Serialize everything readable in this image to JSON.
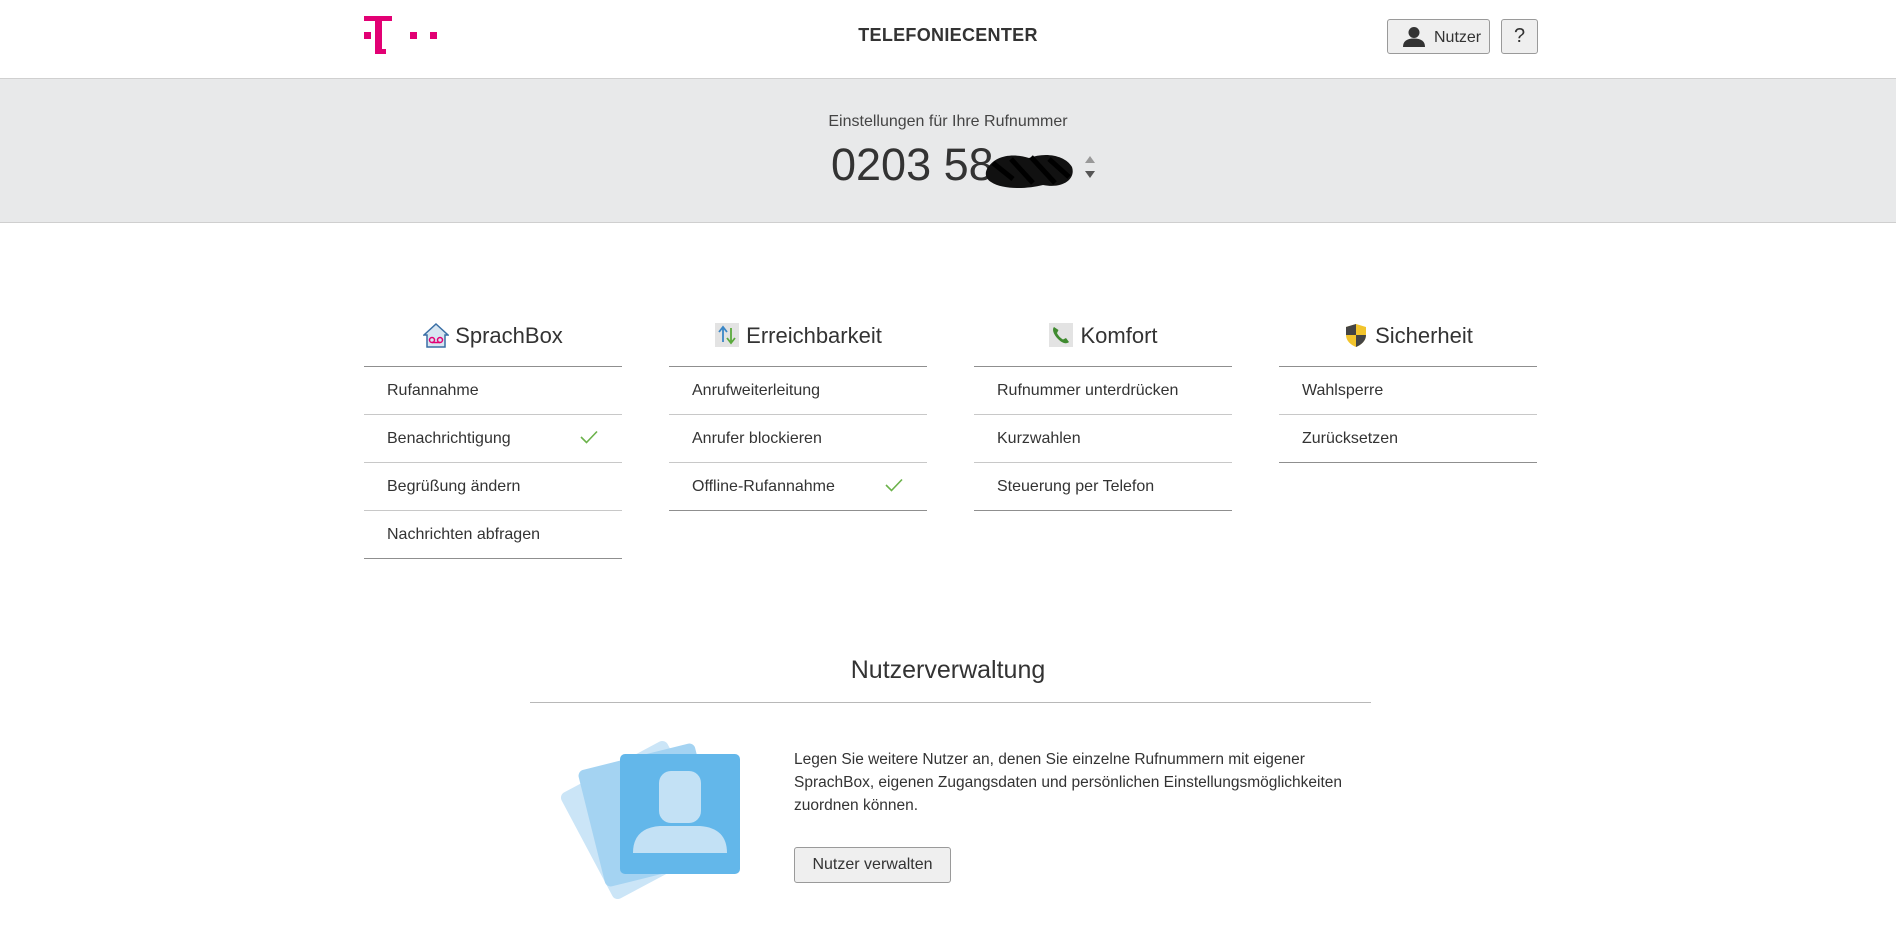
{
  "header": {
    "title": "TELEFONIECENTER",
    "user_button": "Nutzer",
    "help_button": "?",
    "brand_color": "#e20074"
  },
  "number_section": {
    "label": "Einstellungen für Ihre Rufnummer",
    "number_visible": "0203 58"
  },
  "categories": [
    {
      "title": "SprachBox",
      "icon": "voicemail-house-icon",
      "items": [
        {
          "label": "Rufannahme",
          "checked": false
        },
        {
          "label": "Benachrichtigung",
          "checked": true
        },
        {
          "label": "Begrüßung ändern",
          "checked": false
        },
        {
          "label": "Nachrichten abfragen",
          "checked": false
        }
      ]
    },
    {
      "title": "Erreichbarkeit",
      "icon": "arrows-up-down-icon",
      "items": [
        {
          "label": "Anrufweiterleitung",
          "checked": false
        },
        {
          "label": "Anrufer blockieren",
          "checked": false
        },
        {
          "label": "Offline-Rufannahme",
          "checked": true
        }
      ]
    },
    {
      "title": "Komfort",
      "icon": "phone-handset-icon",
      "items": [
        {
          "label": "Rufnummer unterdrücken",
          "checked": false
        },
        {
          "label": "Kurzwahlen",
          "checked": false
        },
        {
          "label": "Steuerung per Telefon",
          "checked": false
        }
      ]
    },
    {
      "title": "Sicherheit",
      "icon": "shield-icon",
      "items": [
        {
          "label": "Wahlsperre",
          "checked": false
        },
        {
          "label": "Zurücksetzen",
          "checked": false
        }
      ]
    }
  ],
  "user_management": {
    "title": "Nutzerverwaltung",
    "description": "Legen Sie weitere Nutzer an, denen Sie einzelne Rufnummern mit eigener SprachBox, eigenen Zugangsdaten und persönlichen Einstellungsmöglichkeiten zuordnen können.",
    "button": "Nutzer verwalten"
  }
}
